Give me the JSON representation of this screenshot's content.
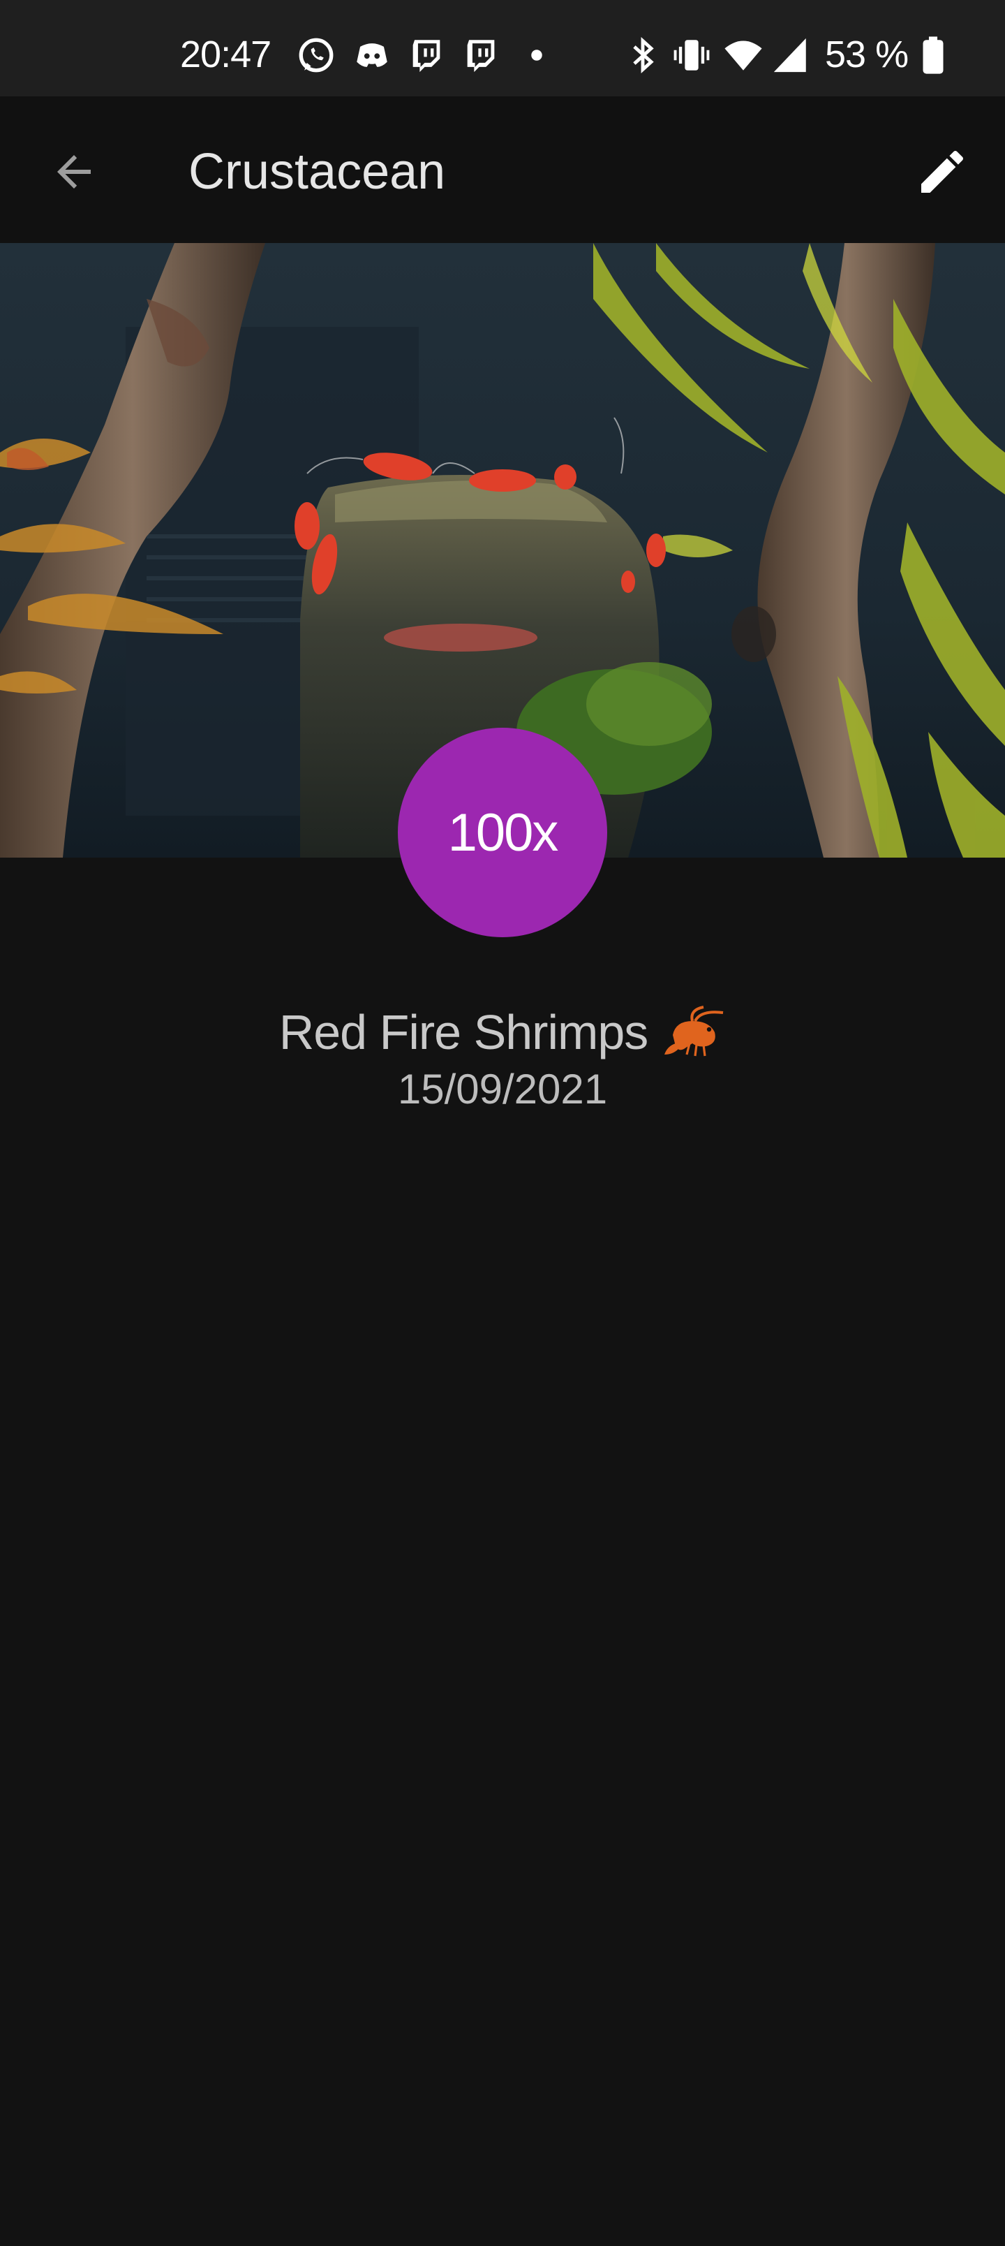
{
  "status_bar": {
    "time": "20:47",
    "battery_percent": "53 %",
    "notification_icons": [
      "whatsapp-icon",
      "discord-icon",
      "twitch-icon",
      "twitch-icon",
      "dot-icon"
    ],
    "system_icons": [
      "bluetooth-icon",
      "vibrate-icon",
      "wifi-icon",
      "cell-signal-icon",
      "battery-icon"
    ]
  },
  "app_bar": {
    "title": "Crustacean",
    "back_icon": "arrow-back-icon",
    "edit_icon": "pencil-icon"
  },
  "hero": {
    "subject": "aquarium-photo"
  },
  "badge": {
    "count": "100x",
    "color": "#9c27b0"
  },
  "item": {
    "name": "Red Fire Shrimps",
    "emoji_icon": "shrimp-icon",
    "date": "15/09/2021"
  },
  "colors": {
    "background": "#121212",
    "status_bar": "#1f1f1f",
    "app_bar": "#111111",
    "accent": "#9c27b0"
  }
}
